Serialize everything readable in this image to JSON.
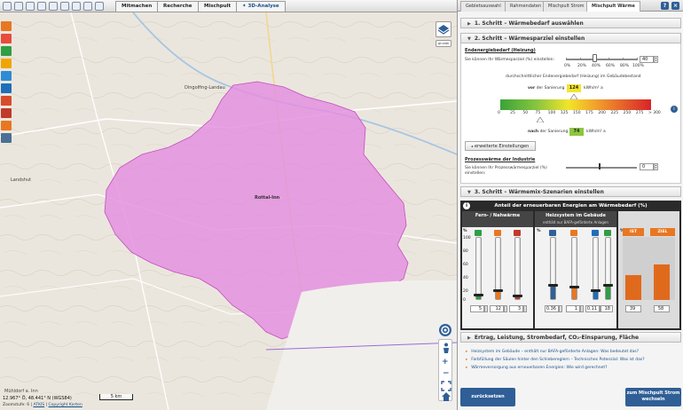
{
  "toolbar": {
    "tabs": [
      "Mitmachen",
      "Recherche",
      "Mischpult",
      "3D-Analyse"
    ]
  },
  "map": {
    "places": [
      "Dingolfing-Landau",
      "Landshut",
      "Rottal-Inn",
      "Mühldorf a. Inn"
    ],
    "coords": "12.967° Ö, 48.441° N (WGS84)",
    "scale": "5 km",
    "footer": {
      "zoom": "Zoomstufe: 6",
      "atkis": "ATKIS",
      "copyright": "Copyright Karten"
    },
    "region_color": "#e38ee0"
  },
  "panel": {
    "tabs": [
      "Gebietsauswahl",
      "Rahmendaten",
      "Mischpult Strom",
      "Mischpult Wärme"
    ],
    "help_label": "?",
    "close_label": "×",
    "step1": "1. Schritt – Wärmebedarf auswählen",
    "step2": "2. Schritt – Wärmesparziel einstellen",
    "endenergie_title": "Endenergiebedarf (Heizung)",
    "endenergie_text": "Sie können Ihr Wärmesparziel (%) einstellen:",
    "endenergie_value": "40",
    "slider_ticks": [
      "0%",
      "20%",
      "40%",
      "60%",
      "80%",
      "100%"
    ],
    "durchschnitt_text": "durchschnittlicher Endenergiebedarf (Heizung) im Gebäudebestand",
    "vor_label": "vor",
    "vor_text": "der Sanierung",
    "vor_value": "124",
    "unit": "kWh/m² a",
    "scale_values": [
      "0",
      "25",
      "50",
      "75",
      "100",
      "125",
      "150",
      "175",
      "200",
      "225",
      "250",
      "275",
      "> 300"
    ],
    "nach_label": "nach",
    "nach_text": "der Sanierung",
    "nach_value": "74",
    "advanced_button": "erweiterte Einstellungen",
    "prozess_title": "Prozesswärme der Industrie",
    "prozess_text": "Sie können Ihr Prozesswärmesparziel (%) einstellen:",
    "prozess_value": "0",
    "step3": "3. Schritt – Wärmemix-Szenarien einstellen",
    "mix_title": "Anteil der erneuerbaren Energien am Wärmebedarf (%)",
    "info_icon_label": "i",
    "group1": "Fern- / Nahwärme",
    "group2": "Heizsystem im Gebäude",
    "group2_sub": "enthält nur BAFA-geförderte Anlagen",
    "axis_labels": [
      "%",
      "100",
      "80",
      "60",
      "40",
      "20",
      "0"
    ],
    "col_values": [
      "5",
      "12",
      "3",
      "0.36",
      "1",
      "0.11",
      "18"
    ],
    "result_labels": [
      "IST",
      "ZIEL"
    ],
    "result_values": [
      "39",
      "58"
    ],
    "step4": "Ertrag, Leistung, Strombedarf, CO₂-Einsparung, Fläche",
    "links": [
      "Heizsystem im Gebäude – enthält nur BAFA-geförderte Anlagen: Was bedeutet das?",
      "Farbfüllung der Säulen hinter den Schiebereglern – Technisches Potenzial: Was ist das?",
      "Wärmeversorgung aus erneuerbaren Energien: Wie wird gerechnet?"
    ],
    "reset_button": "zurücksetzen",
    "switch_button": "zum Mischpult Strom wechseln"
  },
  "colors": {
    "accent": "#2f5f96",
    "orange": "#e87722",
    "region": "#e38ee0"
  }
}
